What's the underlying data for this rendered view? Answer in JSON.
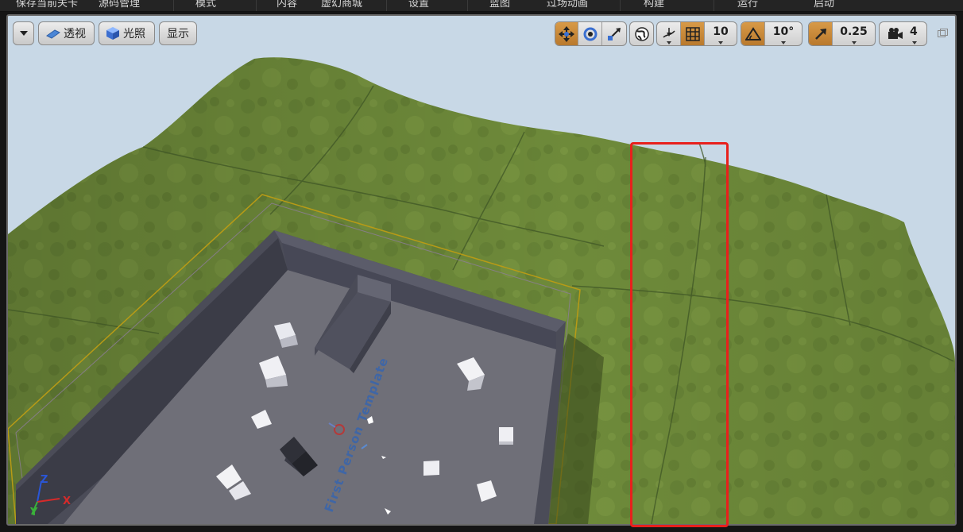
{
  "menu": {
    "items": [
      "保存当前关卡",
      "源码管理",
      "模式",
      "内容",
      "虚幻商城",
      "设置",
      "蓝图",
      "过场动画",
      "构建",
      "运行",
      "启动"
    ]
  },
  "viewport": {
    "view_menu_icon": "chevron-down-icon",
    "perspective_label": "透视",
    "lighting_label": "光照",
    "show_label": "显示",
    "grid_snap_value": "10",
    "rotation_snap_value": "10°",
    "scale_snap_value": "0.25",
    "camera_speed_value": "4",
    "floor_text": "First Person Template",
    "axis": {
      "z": "Z",
      "x": "X",
      "y": "Y"
    }
  },
  "colors": {
    "accent_orange": "#c8893a",
    "highlight_red": "#e8201c",
    "terrain_green": "#6e8a3a",
    "sky": "#c8d8e6",
    "floor_grey": "#6f6f78",
    "wall_grey": "#4b4c58"
  }
}
